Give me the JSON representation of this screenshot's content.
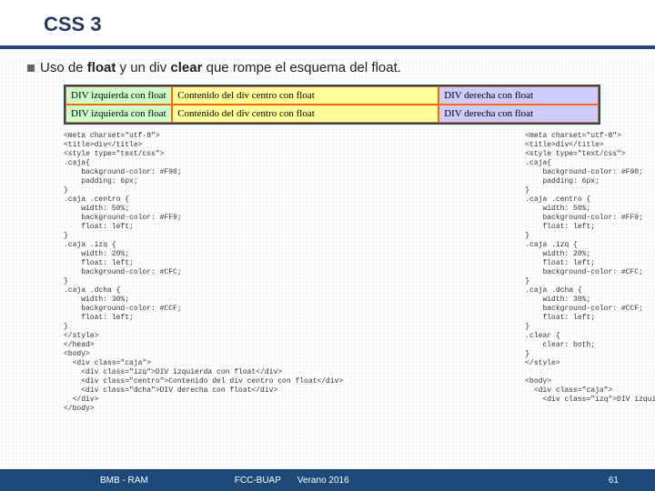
{
  "header": {
    "title": "CSS 3"
  },
  "bullet": {
    "pre": "Uso de ",
    "b1": "float",
    "mid": " y un div ",
    "b2": "clear",
    "post": " que rompe el esquema del float."
  },
  "demo": {
    "row1": {
      "izq": "DIV izquierda con float",
      "centro": "Contenido del div centro con float",
      "dcha": "DIV derecha con float"
    },
    "row2": {
      "izq": "DIV izquierda con float",
      "centro": "Contenido del div centro con float",
      "dcha": "DIV derecha con float"
    }
  },
  "code_left": "<meta charset=\"utf-8\">\n<title>div</title>\n<style type=\"text/css\">\n.caja{\n    background-color: #F90;\n    padding: 6px;\n}\n.caja .centro {\n    width: 50%;\n    background-color: #FF9;\n    float: left;\n}\n.caja .izq {\n    width: 20%;\n    float: left;\n    background-color: #CFC;\n}\n.caja .dcha {\n    width: 30%;\n    background-color: #CCF;\n    float: left;\n}\n</style>\n</head>\n<body>\n  <div class=\"caja\">\n    <div class=\"izq\">DIV izquierda con float</div>\n    <div class=\"centro\">Contenido del div centro con float</div>\n    <div class=\"dcha\">DIV derecha con float</div>\n  </div>\n</body>",
  "code_right": "<meta charset=\"utf-8\">\n<title>div</title>\n<style type=\"text/css\">\n.caja{\n    background-color: #F90;\n    padding: 6px;\n}\n.caja .centro {\n    width: 50%;\n    background-color: #FF9;\n    float: left;\n}\n.caja .izq {\n    width: 20%;\n    float: left;\n    background-color: #CFC;\n}\n.caja .dcha {\n    width: 30%;\n    background-color: #CCF;\n    float: left;\n}\n.clear {\n    clear: both;\n}\n</style>\n\n<body>\n  <div class=\"caja\">\n    <div class=\"izq\">DIV izquierda con float</div>",
  "footer": {
    "left": "BMB - RAM",
    "mid": "FCC-BUAP",
    "mid2": "Verano 2016",
    "right": "61"
  }
}
